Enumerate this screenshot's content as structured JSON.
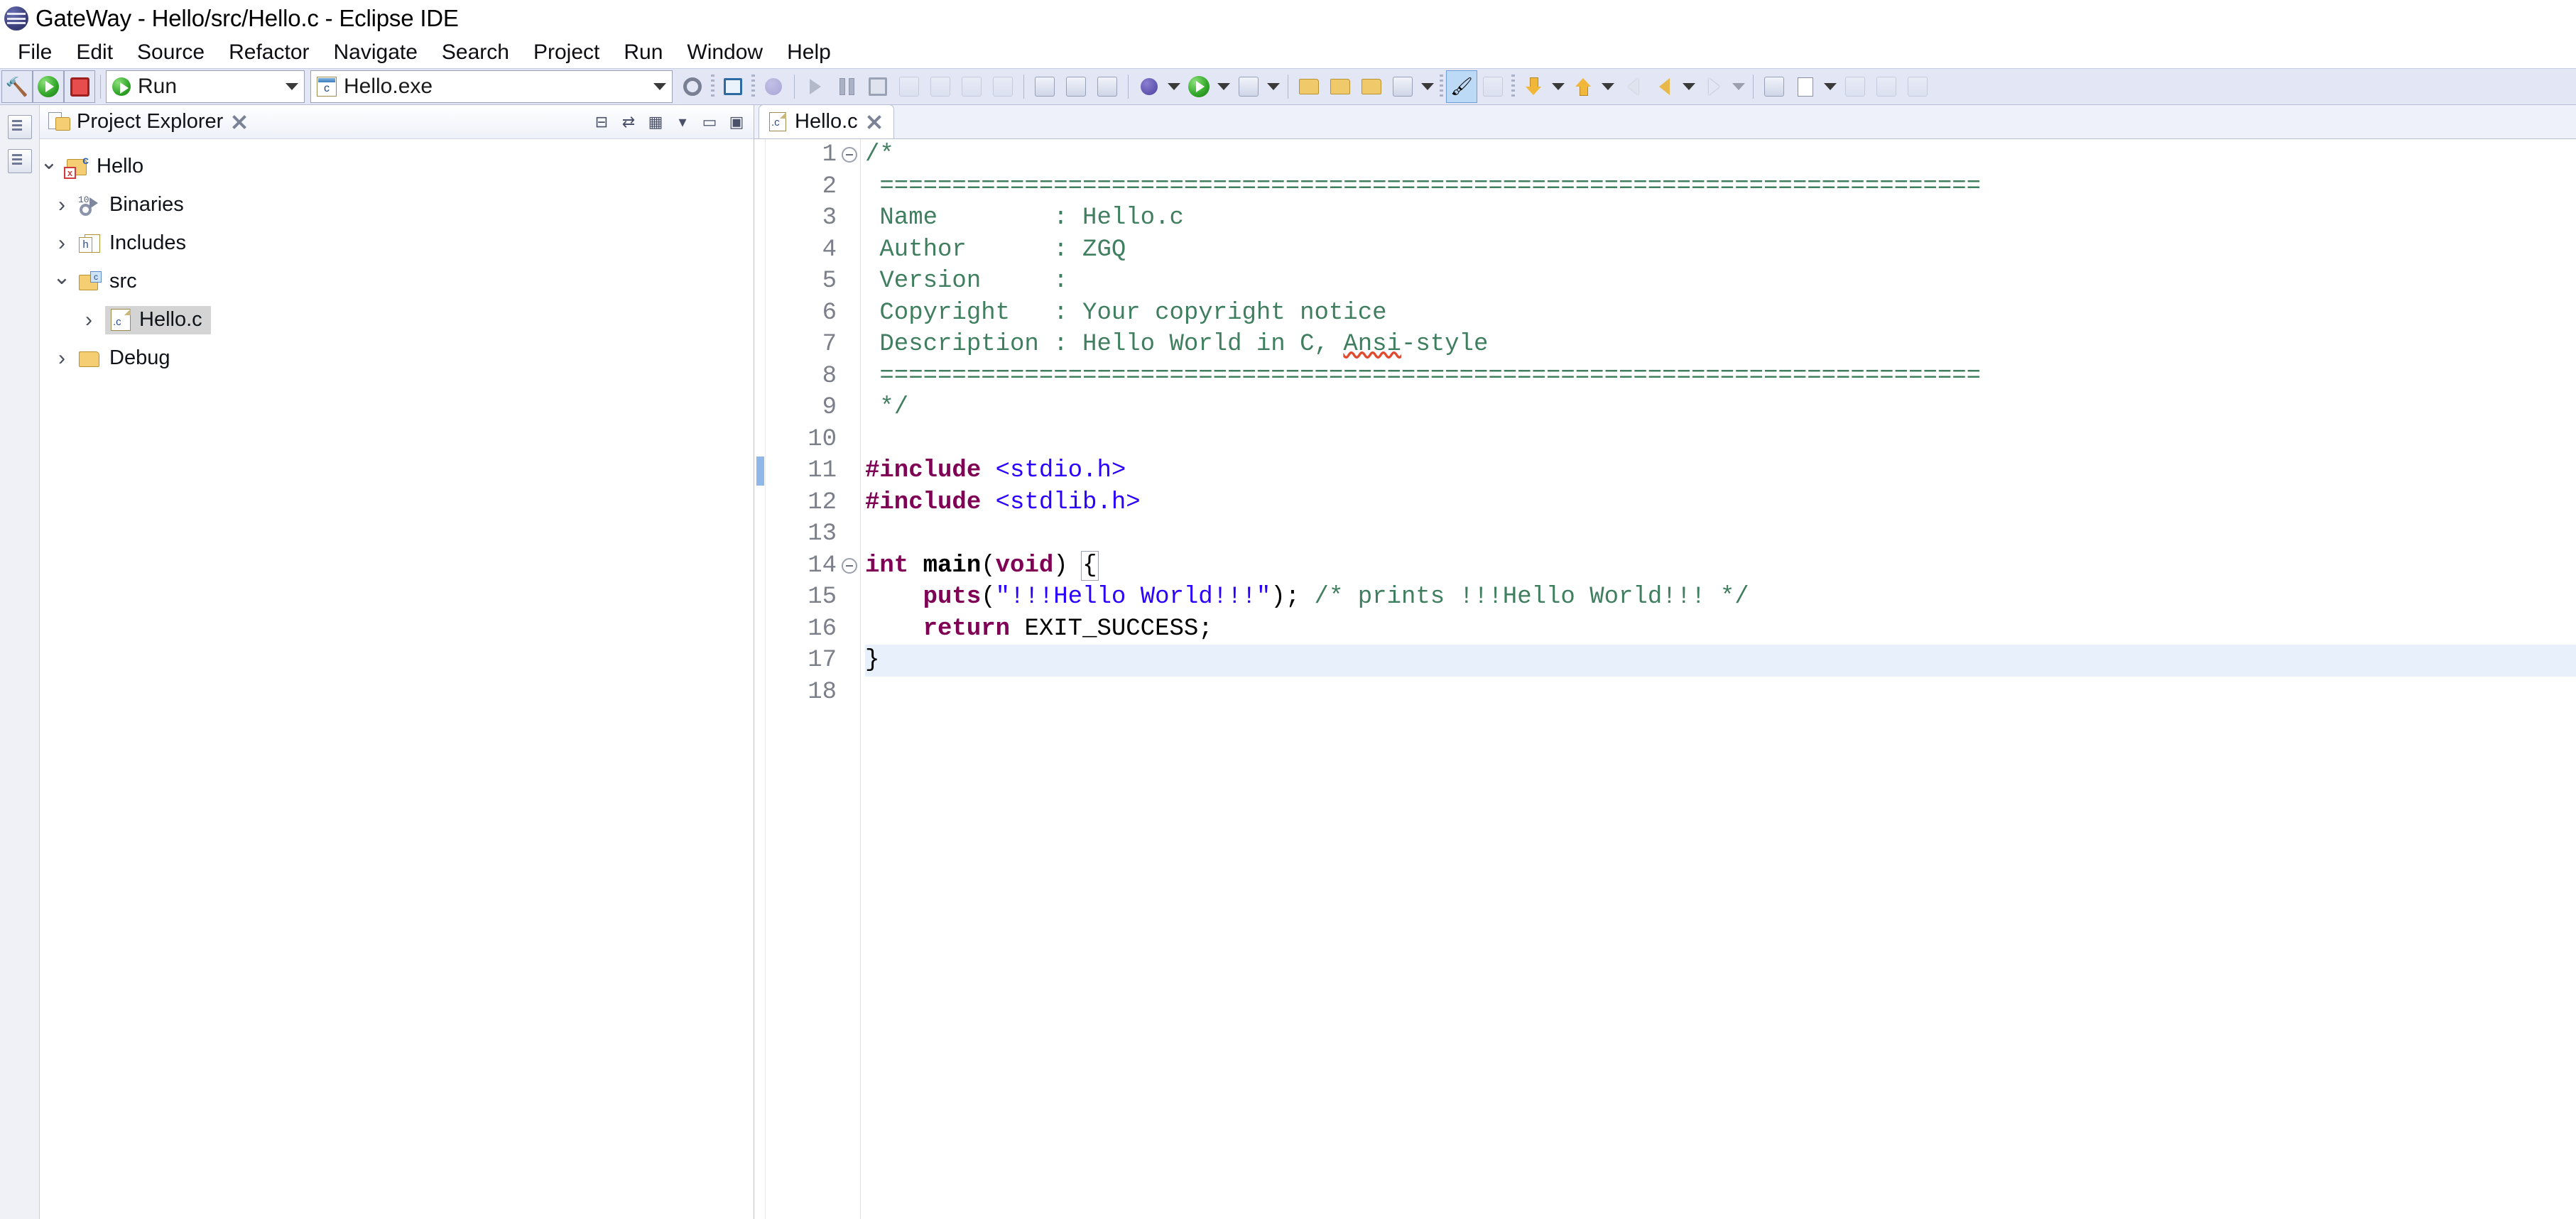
{
  "window": {
    "title": "GateWay - Hello/src/Hello.c - Eclipse IDE",
    "logo_icon": "eclipse-logo-icon"
  },
  "menubar": {
    "items": [
      {
        "label": "File"
      },
      {
        "label": "Edit"
      },
      {
        "label": "Source"
      },
      {
        "label": "Refactor"
      },
      {
        "label": "Navigate"
      },
      {
        "label": "Search"
      },
      {
        "label": "Project"
      },
      {
        "label": "Run"
      },
      {
        "label": "Window"
      },
      {
        "label": "Help"
      }
    ]
  },
  "toolbar": {
    "build_icon": "hammer-icon",
    "run_icon": "run-green-arrow-icon",
    "stop_icon": "stop-red-square-icon",
    "launch_mode": {
      "label": "Run",
      "icon": "run-green-arrow-icon",
      "caret": "chevron-down-icon"
    },
    "launch_config": {
      "label": "Hello.exe",
      "icon": "c-executable-icon",
      "caret": "chevron-down-icon"
    },
    "settings_icon": "gear-icon",
    "debug_group": {
      "console_icon": "console-view-icon",
      "skip_breakpoints_icon": "skip-all-breakpoints-icon",
      "resume_icon": "resume-icon",
      "suspend_icon": "suspend-icon",
      "terminate_icon": "terminate-icon",
      "disconnect_icon": "disconnect-icon",
      "step_into_icon": "step-into-icon",
      "step_over_icon": "step-over-icon",
      "step_return_icon": "step-return-icon"
    },
    "edit_group": {
      "new_c_icon": "new-c-project-icon",
      "toggle_mark_icon": "toggle-mark-occurrences-icon",
      "open_element_icon": "open-element-icon"
    },
    "debug_launch_icons": {
      "debug_icon": "debug-bug-icon",
      "run_icon": "run-green-arrow-icon",
      "external_tools_icon": "external-tools-icon"
    },
    "misc_icons": {
      "new_folder_icon": "new-folder-icon",
      "open_type_icon": "open-type-icon",
      "search_icon": "search-icon",
      "pencil_icon": "pencil-icon",
      "build_all_icon": "build-all-icon",
      "next_annotation_icon": "next-annotation-icon",
      "prev_annotation_icon": "previous-annotation-icon",
      "back_icon": "back-arrow-icon",
      "forward_icon": "forward-arrow-icon",
      "new_window_icon": "new-window-icon",
      "new_editor_icon": "new-editor-icon",
      "save_icon": "save-icon",
      "save_all_icon": "save-all-icon",
      "print_icon": "print-icon"
    }
  },
  "rail": {
    "items": [
      {
        "name": "restore-project-explorer",
        "icon": "panel-restore-icon"
      },
      {
        "name": "outline-view",
        "icon": "outline-view-icon"
      }
    ]
  },
  "explorer": {
    "title": "Project Explorer",
    "view_icon": "project-explorer-icon",
    "toolbar": {
      "collapse_all_icon": "collapse-all-icon",
      "link_editor_icon": "link-with-editor-icon",
      "focus_icon": "focus-on-active-task-icon",
      "view_menu_icon": "view-menu-chevron-icon",
      "minimize_icon": "minimize-icon",
      "maximize_icon": "maximize-icon",
      "close_icon": "close-icon"
    },
    "tree": [
      {
        "label": "Hello",
        "depth": 0,
        "twisty": "open",
        "icon": "c-project-error-icon",
        "selected": false
      },
      {
        "label": "Binaries",
        "depth": 1,
        "twisty": "closed",
        "icon": "binaries-icon",
        "selected": false
      },
      {
        "label": "Includes",
        "depth": 1,
        "twisty": "closed",
        "icon": "includes-icon",
        "selected": false
      },
      {
        "label": "src",
        "depth": 1,
        "twisty": "open",
        "icon": "source-folder-icon",
        "selected": false
      },
      {
        "label": "Hello.c",
        "depth": 2,
        "twisty": "closed",
        "icon": "c-file-icon",
        "selected": true
      },
      {
        "label": "Debug",
        "depth": 1,
        "twisty": "closed",
        "icon": "folder-icon",
        "selected": false
      }
    ]
  },
  "editor": {
    "tabs": [
      {
        "label": "Hello.c",
        "icon": "c-file-icon",
        "active": true,
        "close_icon": "close-icon"
      }
    ],
    "current_line": 17,
    "changebar_lines": [
      11
    ],
    "fold_lines": [
      1,
      14
    ],
    "lines": [
      {
        "n": 1,
        "tokens": [
          {
            "t": "/*",
            "c": "cm"
          }
        ]
      },
      {
        "n": 2,
        "tokens": [
          {
            "t": " ============================================================================",
            "c": "cm"
          }
        ]
      },
      {
        "n": 3,
        "tokens": [
          {
            "t": " Name        : Hello.c",
            "c": "cm"
          }
        ]
      },
      {
        "n": 4,
        "tokens": [
          {
            "t": " Author      : ZGQ",
            "c": "cm"
          }
        ]
      },
      {
        "n": 5,
        "tokens": [
          {
            "t": " Version     :",
            "c": "cm"
          }
        ]
      },
      {
        "n": 6,
        "tokens": [
          {
            "t": " Copyright   : Your copyright notice",
            "c": "cm"
          }
        ]
      },
      {
        "n": 7,
        "tokens": [
          {
            "t": " Description : Hello World in C, ",
            "c": "cm"
          },
          {
            "t": "Ansi",
            "c": "cm misspell"
          },
          {
            "t": "-style",
            "c": "cm"
          }
        ]
      },
      {
        "n": 8,
        "tokens": [
          {
            "t": " ============================================================================",
            "c": "cm"
          }
        ]
      },
      {
        "n": 9,
        "tokens": [
          {
            "t": " */",
            "c": "cm"
          }
        ]
      },
      {
        "n": 10,
        "tokens": []
      },
      {
        "n": 11,
        "tokens": [
          {
            "t": "#include",
            "c": "pp"
          },
          {
            "t": " ",
            "c": "pl"
          },
          {
            "t": "<stdio.h>",
            "c": "str"
          }
        ]
      },
      {
        "n": 12,
        "tokens": [
          {
            "t": "#include",
            "c": "pp"
          },
          {
            "t": " ",
            "c": "pl"
          },
          {
            "t": "<stdlib.h>",
            "c": "str"
          }
        ]
      },
      {
        "n": 13,
        "tokens": []
      },
      {
        "n": 14,
        "tokens": [
          {
            "t": "int",
            "c": "kw"
          },
          {
            "t": " ",
            "c": "pl"
          },
          {
            "t": "main",
            "c": "fn"
          },
          {
            "t": "(",
            "c": "pl"
          },
          {
            "t": "void",
            "c": "kw"
          },
          {
            "t": ") ",
            "c": "pl"
          },
          {
            "t": "{",
            "c": "pl bracket-box"
          }
        ]
      },
      {
        "n": 15,
        "tokens": [
          {
            "t": "    ",
            "c": "pl"
          },
          {
            "t": "puts",
            "c": "kw"
          },
          {
            "t": "(",
            "c": "pl"
          },
          {
            "t": "\"!!!Hello World!!!\"",
            "c": "str"
          },
          {
            "t": "); ",
            "c": "pl"
          },
          {
            "t": "/* prints !!!Hello World!!! */",
            "c": "cm"
          }
        ]
      },
      {
        "n": 16,
        "tokens": [
          {
            "t": "    ",
            "c": "pl"
          },
          {
            "t": "return",
            "c": "kw"
          },
          {
            "t": " EXIT_SUCCESS;",
            "c": "pl"
          }
        ]
      },
      {
        "n": 17,
        "tokens": [
          {
            "t": "}",
            "c": "pl"
          }
        ]
      },
      {
        "n": 18,
        "tokens": []
      }
    ]
  }
}
